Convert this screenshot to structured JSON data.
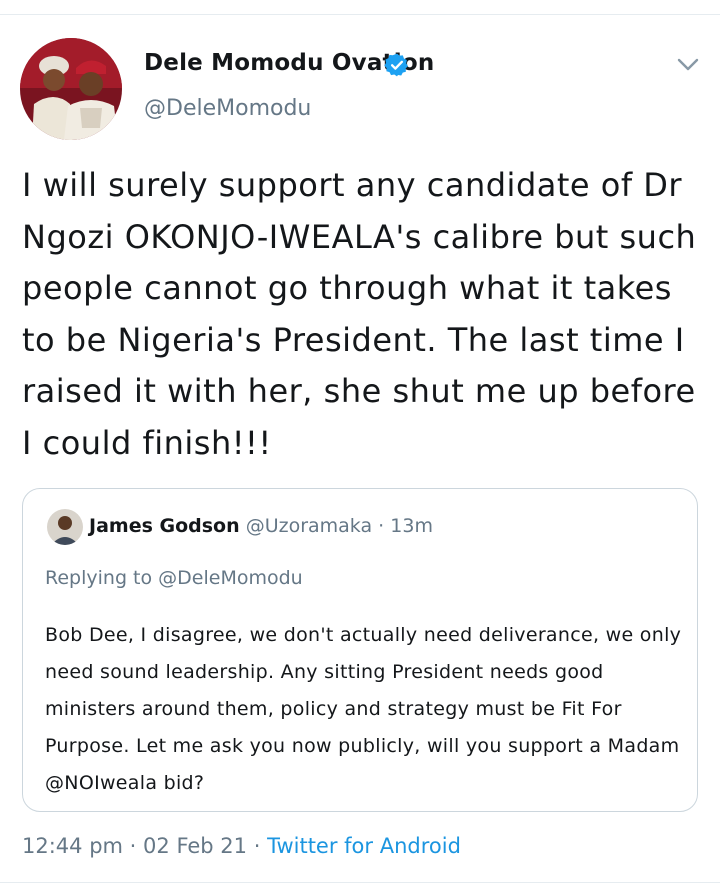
{
  "tweet": {
    "author_name": "Dele Momodu Ovation",
    "author_handle": "@DeleMomodu",
    "text": "I will surely support any candidate of Dr Ngozi OKONJO-IWEALA's calibre but such people cannot go through what it takes to be Nigeria's President. The last time I raised it with her, she shut me up before I could finish!!!",
    "time": "12:44 pm",
    "date": "02 Feb 21",
    "source": "Twitter for Android",
    "separator": "·"
  },
  "quoted_tweet": {
    "author_name": "James Godson",
    "author_handle": "@Uzoramaka",
    "separator": "·",
    "time_ago": "13m",
    "replying_to": "Replying to @DeleMomodu",
    "text": "Bob Dee, I disagree, we don't actually need deliverance, we only need sound leadership. Any sitting President needs good ministers around them, policy and strategy must be Fit For Purpose. Let me ask you now publicly, will you support a Madam @NOIweala bid?"
  },
  "icons": {
    "verified": "verified-badge-icon",
    "menu": "chevron-down-icon"
  },
  "colors": {
    "verified": "#1da1f2",
    "link": "#1b95e0",
    "secondary_text": "#657786",
    "border": "#ccd6dd"
  }
}
